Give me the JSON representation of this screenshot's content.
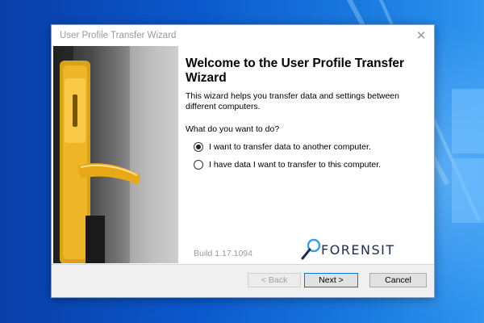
{
  "window": {
    "title": "User Profile Transfer Wizard",
    "close_glyph": "✕"
  },
  "content": {
    "heading": "Welcome to the User Profile Transfer Wizard",
    "description": "This wizard helps you transfer data and settings between different computers.",
    "question": "What do you want to do?",
    "options": [
      {
        "label": "I want to transfer data to another computer.",
        "selected": true
      },
      {
        "label": "I have data I want to transfer to this computer.",
        "selected": false
      }
    ],
    "build": "Build 1.17.1094",
    "logo_text": "FORENSIT"
  },
  "buttons": {
    "back": "< Back",
    "next": "Next >",
    "cancel": "Cancel"
  },
  "icons": {
    "close": "close-icon",
    "logo": "magnifier-logo-icon",
    "hero": "door-handle-image"
  },
  "colors": {
    "desktop": "#0b58cc",
    "accent": "#0078d7",
    "footer": "#f0f0f0"
  }
}
